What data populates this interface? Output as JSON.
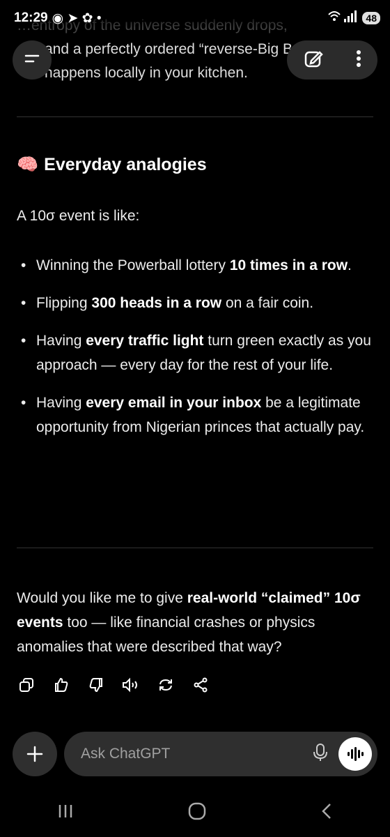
{
  "status_bar": {
    "time": "12:29",
    "battery": "48"
  },
  "scrolled": {
    "line1_dim": "…entropy of the universe suddenly drops,",
    "line2": "and a perfectly ordered “reverse-Big Bang”",
    "line3": "happens locally in your kitchen."
  },
  "section": {
    "emoji": "🧠",
    "heading": "Everyday analogies",
    "intro": "A 10σ event is like:",
    "bullets": [
      {
        "pre": "Winning the Powerball lottery ",
        "bold": "10 times in a row",
        "post": "."
      },
      {
        "pre": "Flipping ",
        "bold": "300 heads in a row",
        "post": " on a fair coin."
      },
      {
        "pre": "Having ",
        "bold": "every traffic light",
        "post": " turn green exactly as you approach — every day for the rest of your life."
      },
      {
        "pre": "Having ",
        "bold": "every email in your inbox",
        "post": " be a legitimate opportunity from Nigerian princes that actually pay."
      }
    ]
  },
  "followup": {
    "pre": "Would you like me to give ",
    "bold": "real-world “claimed” 10σ events",
    "post": " too — like financial crashes or physics anomalies that were described that way?"
  },
  "actions": [
    "copy-icon",
    "thumbs-up-icon",
    "thumbs-down-icon",
    "read-aloud-icon",
    "regenerate-icon",
    "share-icon"
  ],
  "composer": {
    "placeholder": "Ask ChatGPT"
  },
  "colors": {
    "background": "#000000",
    "surface": "#2f2f2f",
    "text": "#ececec"
  }
}
